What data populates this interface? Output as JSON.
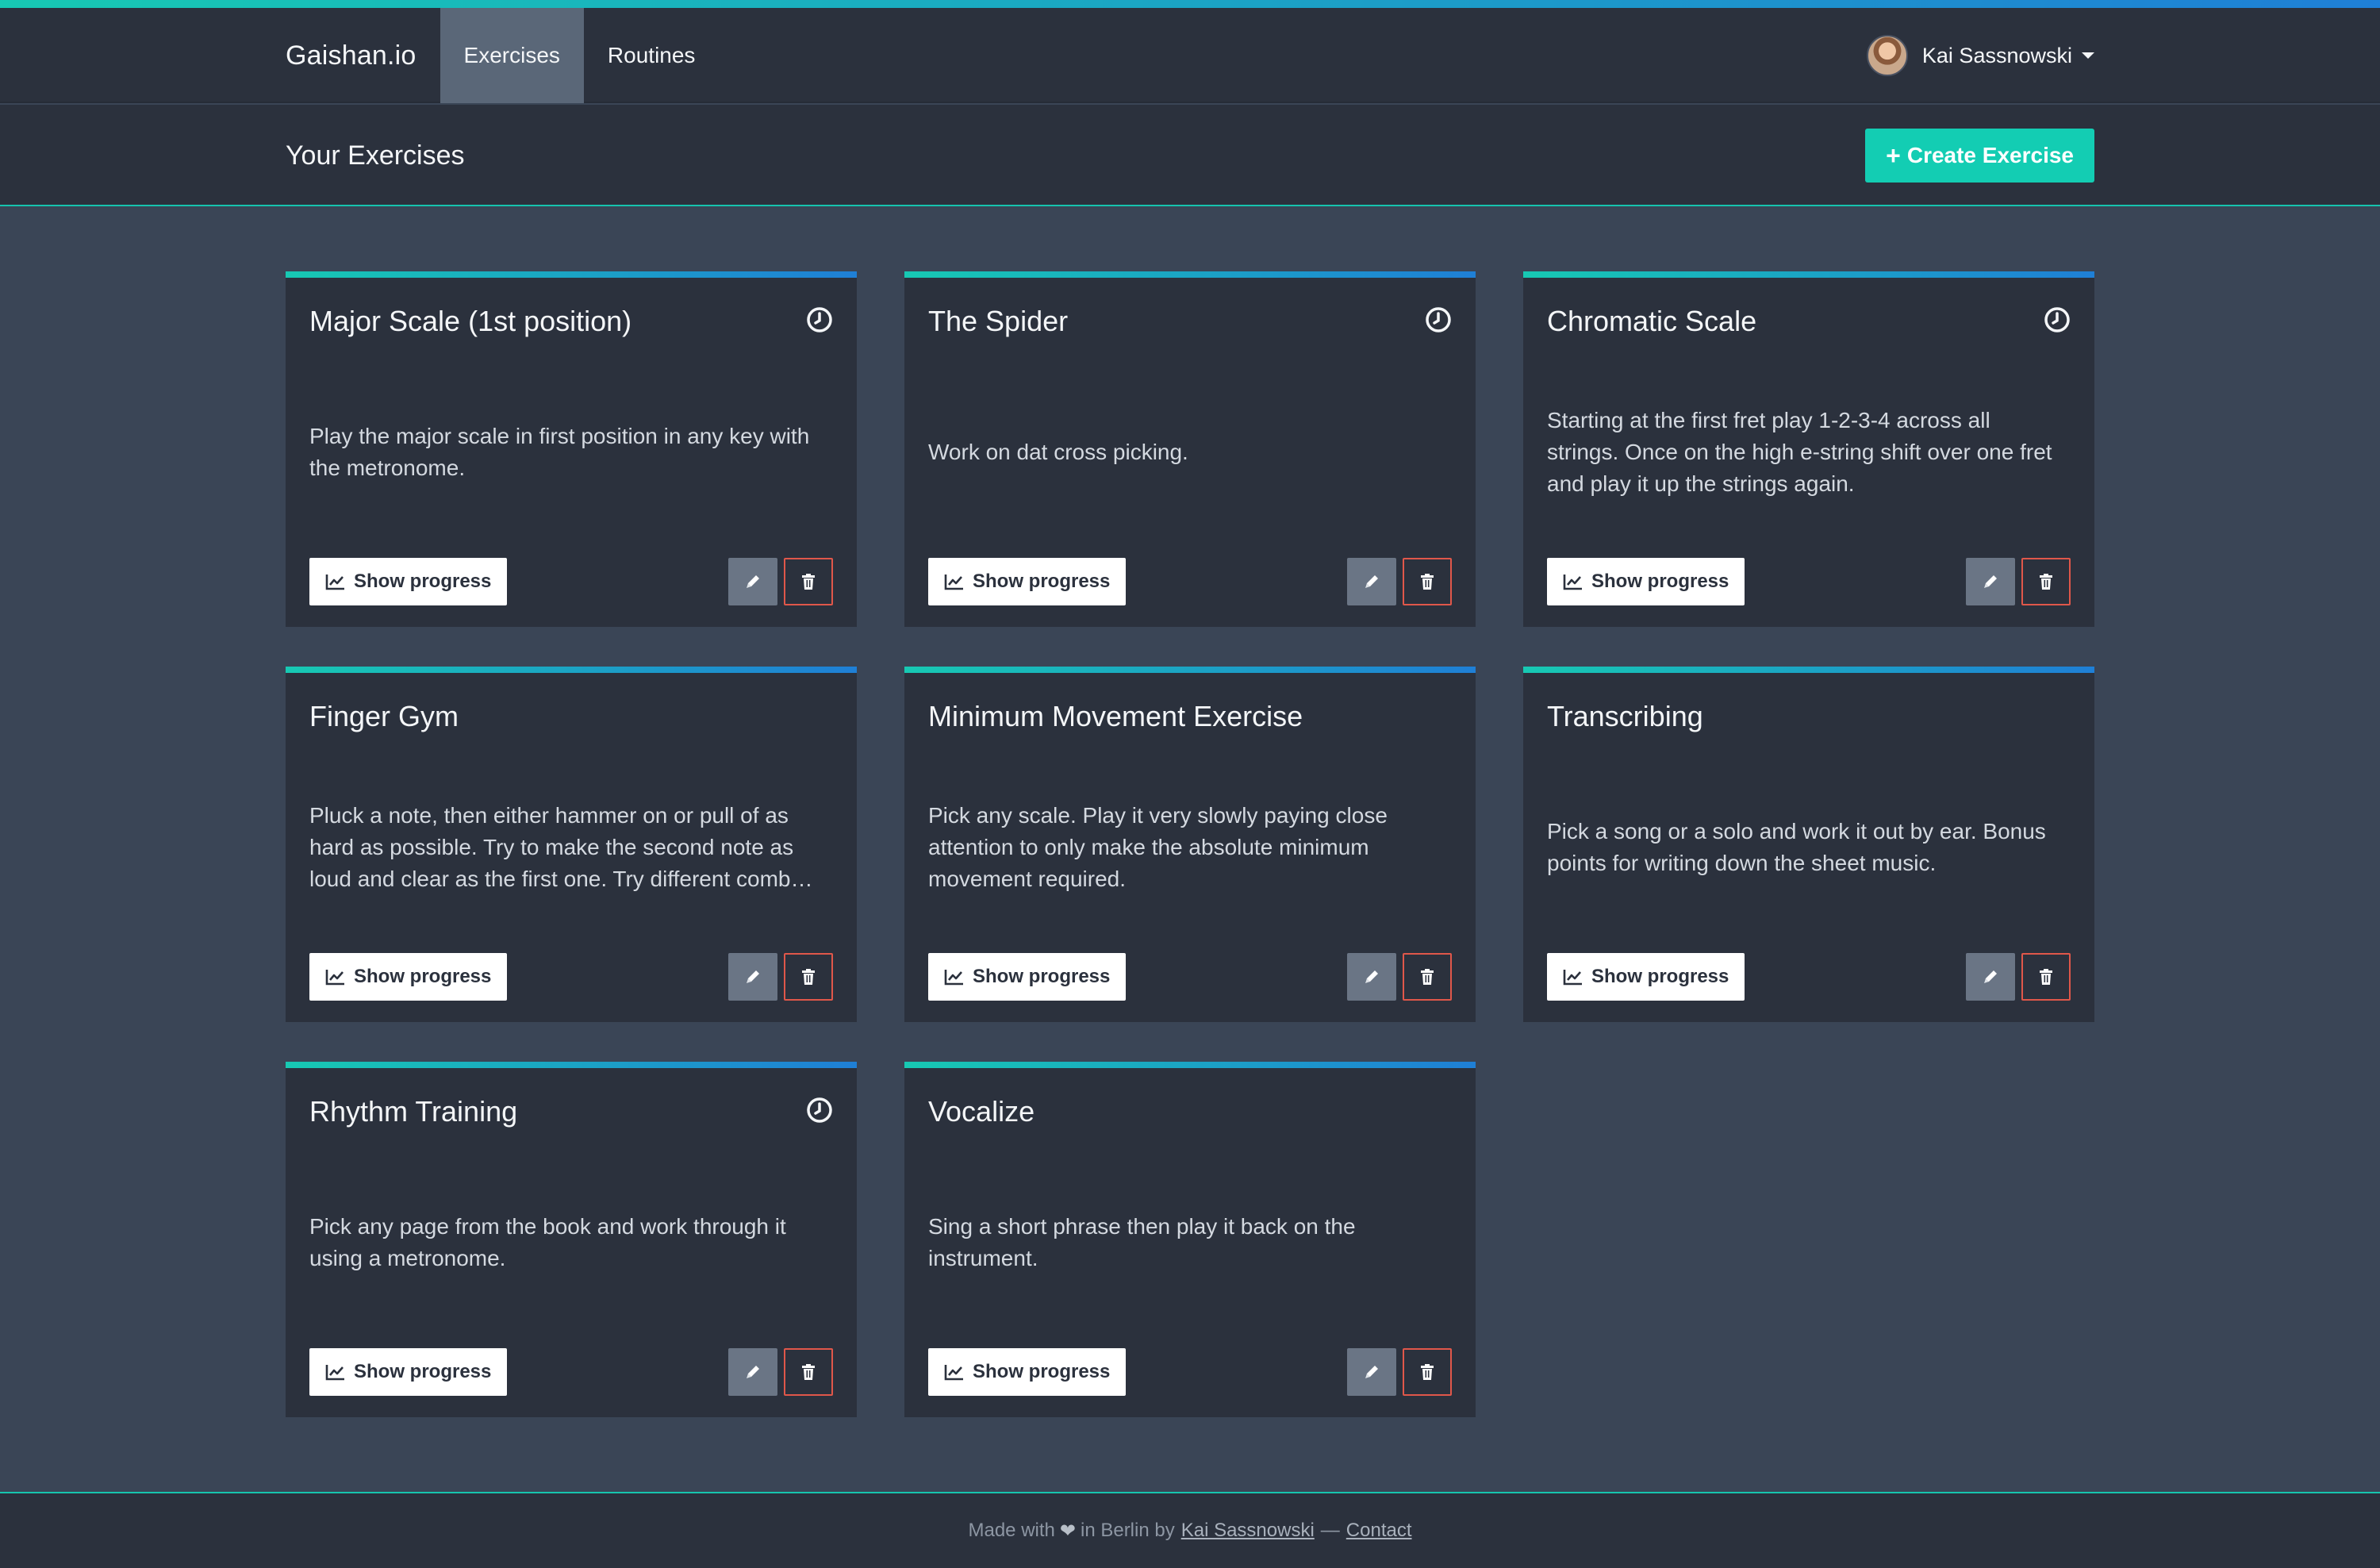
{
  "nav": {
    "brand": "Gaishan.io",
    "links": [
      {
        "label": "Exercises",
        "active": true
      },
      {
        "label": "Routines",
        "active": false
      }
    ],
    "user_name": "Kai Sassnowski"
  },
  "header": {
    "title": "Your Exercises",
    "create_label": "Create Exercise"
  },
  "buttons": {
    "progress_label": "Show progress"
  },
  "exercises": [
    {
      "title": "Major Scale (1st position)",
      "has_timer": true,
      "description": "Play the major scale in first position in any key with the metronome."
    },
    {
      "title": "The Spider",
      "has_timer": true,
      "description": "Work on dat cross picking."
    },
    {
      "title": "Chromatic Scale",
      "has_timer": true,
      "description": "Starting at the first fret play 1-2-3-4 across all strings. Once on the high e-string shift over one fret and play it up the strings again."
    },
    {
      "title": "Finger Gym",
      "has_timer": false,
      "description": "Pluck a note, then either hammer on or pull of as hard as possible. Try to make the second note as loud and clear as the first one. Try different comb…"
    },
    {
      "title": "Minimum Movement Exercise",
      "has_timer": false,
      "description": "Pick any scale. Play it very slowly paying close attention to only make the absolute minimum movement required."
    },
    {
      "title": "Transcribing",
      "has_timer": false,
      "description": "Pick a song or a solo and work it out by ear. Bonus points for writing down the sheet music."
    },
    {
      "title": "Rhythm Training",
      "has_timer": true,
      "description": "Pick any page from the book and work through it using a metronome."
    },
    {
      "title": "Vocalize",
      "has_timer": false,
      "description": "Sing a short phrase then play it back on the instrument."
    }
  ],
  "footer": {
    "made_with": "Made with",
    "in_berlin_by": "in Berlin by",
    "author_link": "Kai Sassnowski",
    "separator": "—",
    "contact_link": "Contact"
  },
  "colors": {
    "accent_teal": "#13cdb3",
    "accent_blue": "#1f7fd6",
    "danger": "#e0574a",
    "panel": "#2b313d",
    "background": "#3a4556"
  },
  "icons": {
    "timer": "clock-icon",
    "progress": "chart-line-icon",
    "edit": "pencil-icon",
    "delete": "trash-icon",
    "create": "plus-icon",
    "footer": "heart-icon"
  }
}
